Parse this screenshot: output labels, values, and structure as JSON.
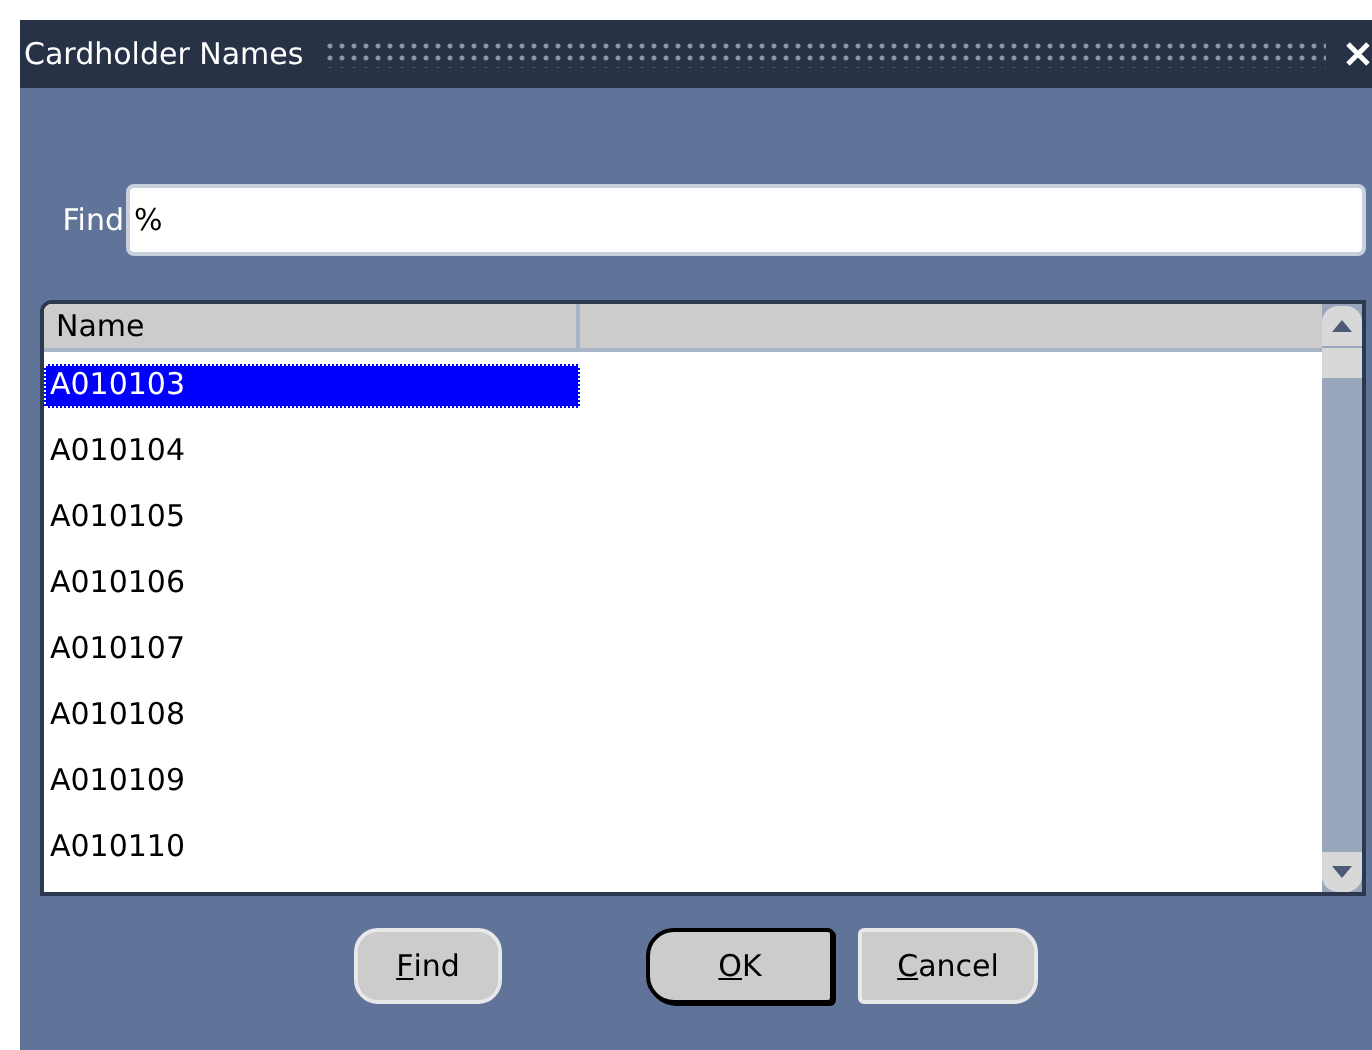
{
  "window": {
    "title": "Cardholder Names"
  },
  "find": {
    "label": "Find",
    "value": "%"
  },
  "table": {
    "columns": [
      "Name"
    ],
    "rows": [
      {
        "name": "A010103",
        "selected": true
      },
      {
        "name": "A010104",
        "selected": false
      },
      {
        "name": "A010105",
        "selected": false
      },
      {
        "name": "A010106",
        "selected": false
      },
      {
        "name": "A010107",
        "selected": false
      },
      {
        "name": "A010108",
        "selected": false
      },
      {
        "name": "A010109",
        "selected": false
      },
      {
        "name": "A010110",
        "selected": false
      }
    ]
  },
  "buttons": [
    {
      "kind": "find",
      "mnemonic": "F",
      "rest": "ind",
      "default": false
    },
    {
      "kind": "ok",
      "mnemonic": "O",
      "rest": "K",
      "default": true
    },
    {
      "kind": "cancel",
      "mnemonic": "C",
      "rest": "ancel",
      "default": false
    }
  ]
}
